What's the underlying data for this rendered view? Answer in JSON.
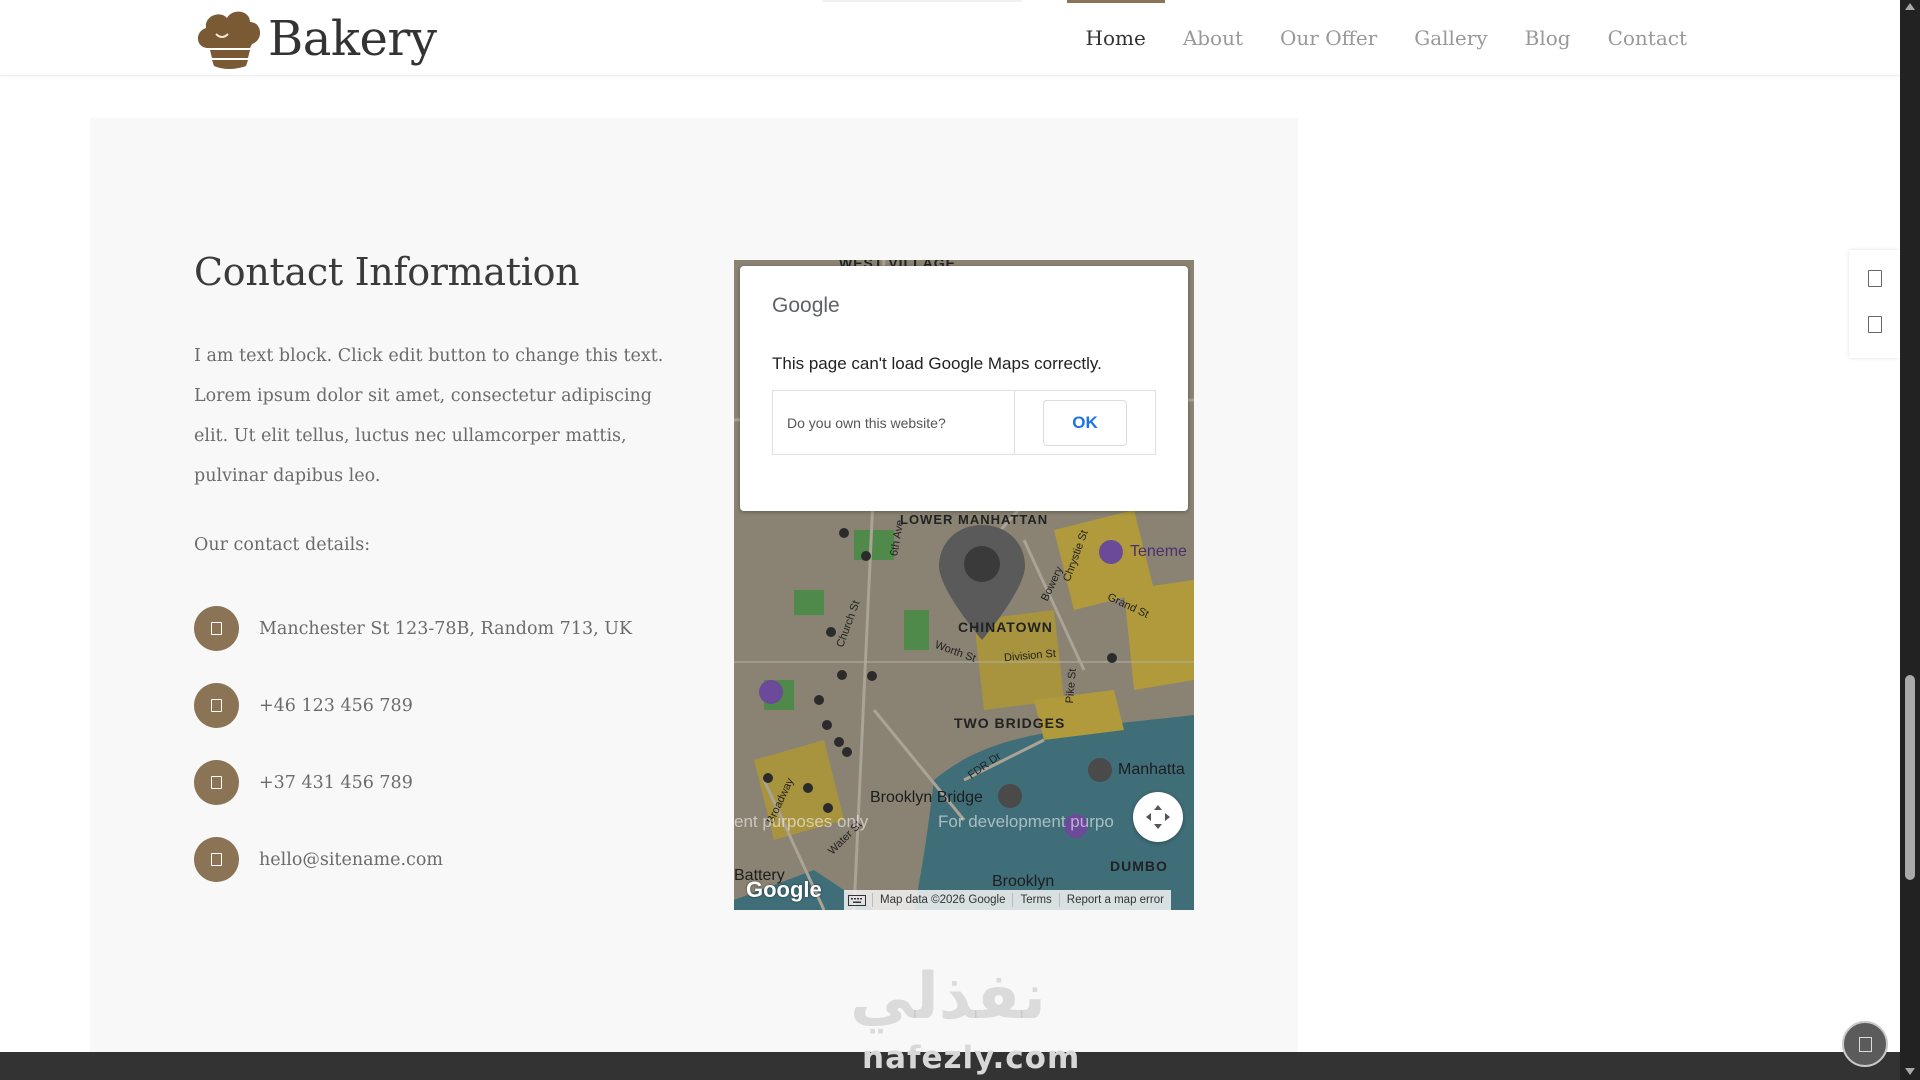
{
  "site": {
    "brand": "Bakery",
    "logo_icon": "chef-hat-icon",
    "accent_color": "#8b7355"
  },
  "nav": {
    "items": [
      {
        "label": "Home",
        "active": true
      },
      {
        "label": "About"
      },
      {
        "label": "Our Offer"
      },
      {
        "label": "Gallery"
      },
      {
        "label": "Blog"
      },
      {
        "label": "Contact"
      }
    ]
  },
  "contact": {
    "title": "Contact Information",
    "body": "I am text block. Click edit button to change this text. Lorem ipsum dolor sit amet, consectetur adipiscing elit. Ut elit tellus, luctus nec ullamcorper mattis, pulvinar dapibus leo.",
    "details_heading": "Our contact details:",
    "details": [
      {
        "icon": "map-marker-icon",
        "text": "Manchester St 123-78B, Random 713, UK"
      },
      {
        "icon": "phone-icon",
        "text": "+46 123 456 789"
      },
      {
        "icon": "mobile-phone-icon",
        "text": "+37 431 456 789"
      },
      {
        "icon": "envelope-icon",
        "text": "hello@sitename.com"
      }
    ]
  },
  "map": {
    "dialog": {
      "brand": "Google",
      "message": "This page can't load Google Maps correctly.",
      "question": "Do you own this website?",
      "ok_label": "OK"
    },
    "labels": {
      "west_village": "WEST VILLAGE",
      "lower_manhattan": "LOWER MANHATTAN",
      "chinatown": "CHINATOWN",
      "two_bridges": "TWO BRIDGES",
      "dumbo": "DUMBO",
      "brooklyn": "Brooklyn",
      "brooklyn_bridge": "Brooklyn Bridge",
      "tenement": "Teneme",
      "manhatta": "Manhatta",
      "battery": "Battery",
      "sixth_ave": "6th Ave",
      "bowery": "Bowery",
      "chrystie_st": "Chrystie St",
      "grand_st": "Grand St",
      "church_st": "Church St",
      "worth_st": "Worth St",
      "division_st": "Division St",
      "pike_st": "Pike St",
      "fdr_dr": "FDR Dr",
      "broadway": "Broadway",
      "water_st": "Water St",
      "dev_left": "ent purposes only",
      "dev_right": "For development purpo"
    },
    "google_logo": "Google",
    "attribution": {
      "data": "Map data ©2026 Google",
      "terms": "Terms",
      "report": "Report a map error"
    }
  },
  "watermark": {
    "arabic": "نفذلي",
    "latin": "nafezly.com"
  },
  "side_panel": {
    "icons": [
      "share-icon",
      "cart-icon"
    ]
  }
}
